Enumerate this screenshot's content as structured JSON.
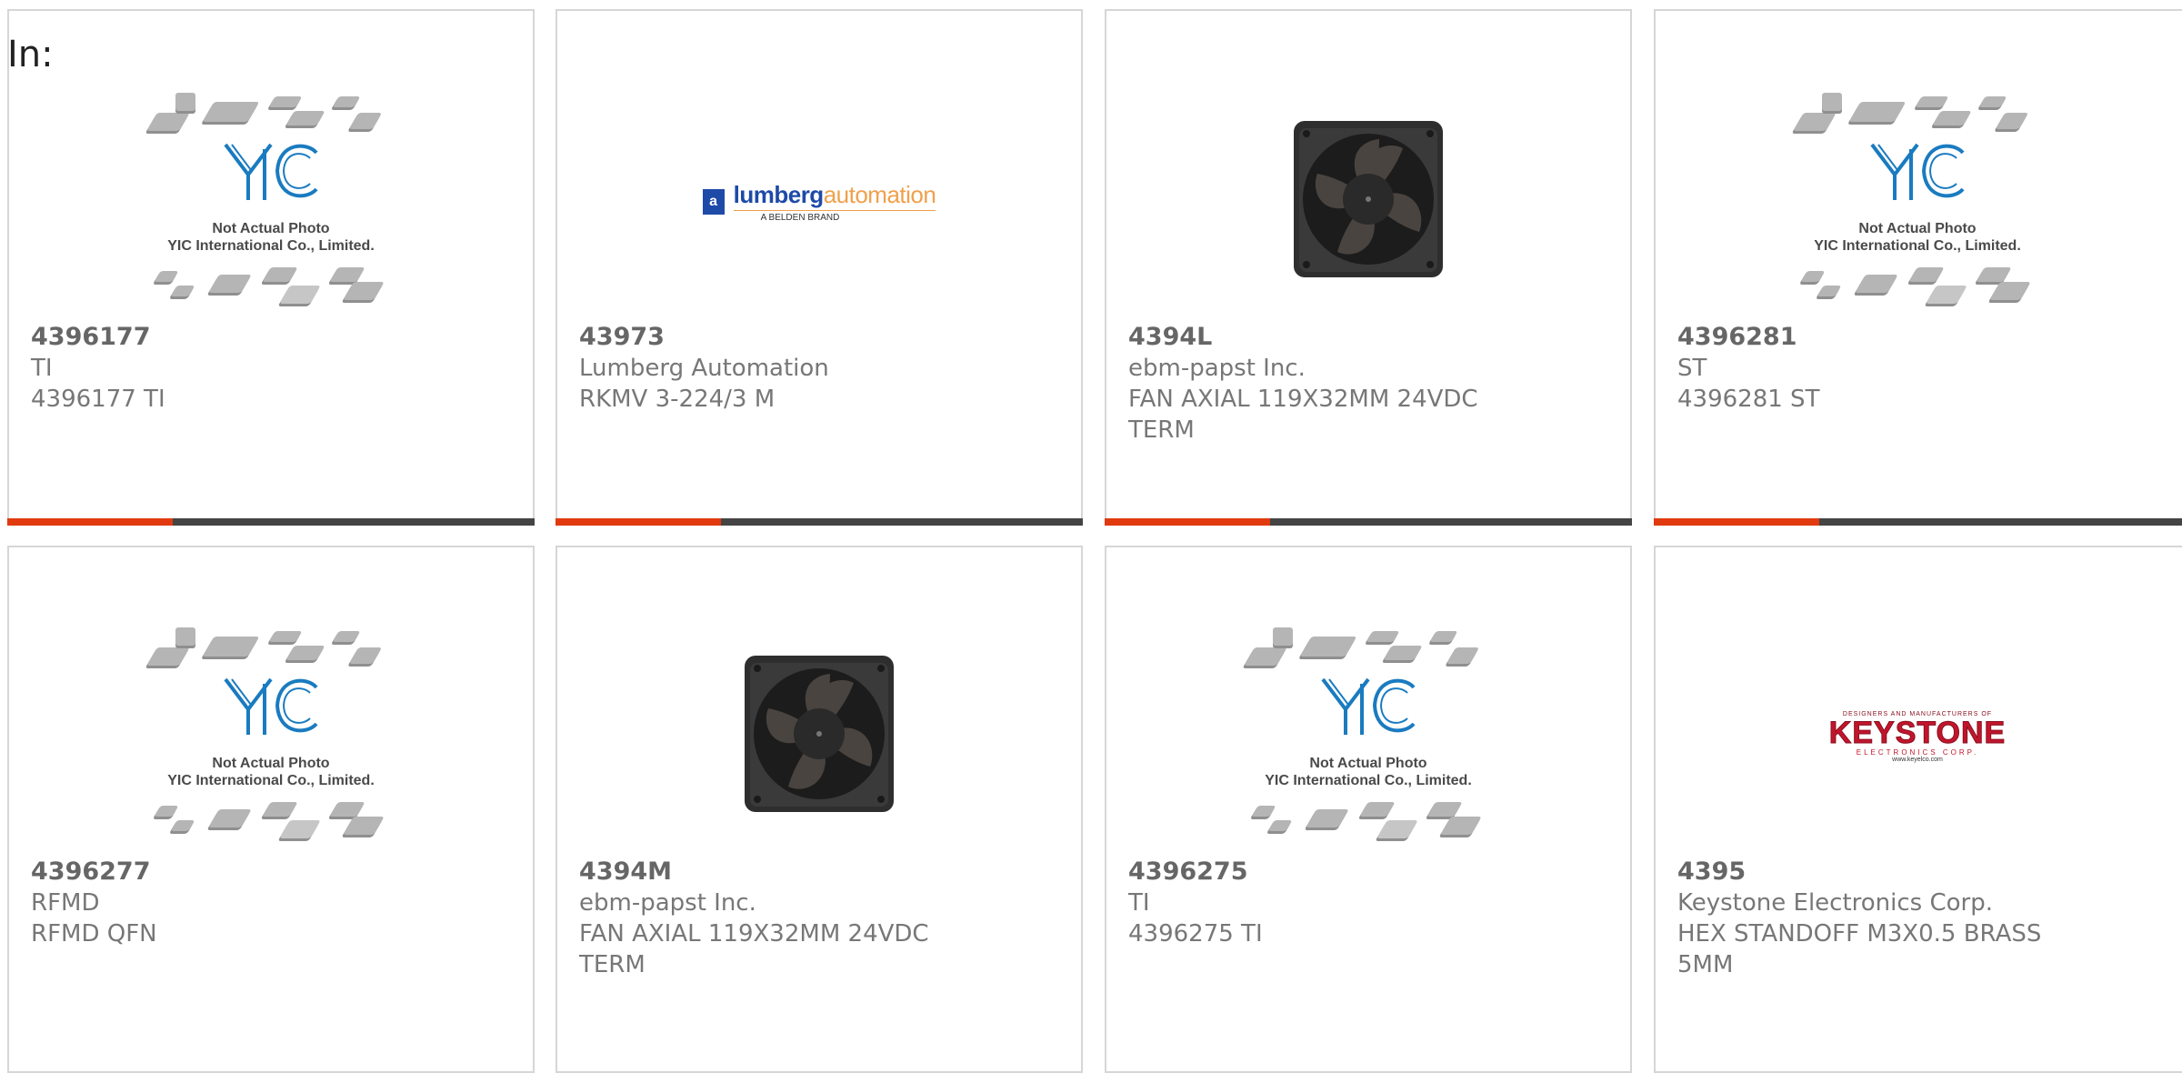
{
  "page": {
    "in_label": "In:"
  },
  "colors": {
    "accent": "#e03a0e",
    "bar": "#444444",
    "border": "#d6d6d6",
    "yic_blue": "#1a7bc0"
  },
  "placeholder": {
    "line1": "Not Actual Photo",
    "line2": "YIC International Co., Limited.",
    "logo_text": "YIC"
  },
  "logos": {
    "lumberg": {
      "mark": "a",
      "word1": "lumberg",
      "word2": "automation",
      "tagline": "A BELDEN BRAND"
    },
    "keystone": {
      "top": "DESIGNERS AND MANUFACTURERS OF",
      "main": "KEYSTONE",
      "mid": "ELECTRONICS CORP.",
      "url": "www.keyelco.com"
    }
  },
  "products": [
    {
      "part_number": "4396177",
      "manufacturer": "TI",
      "description": "4396177 TI",
      "image": "yic-placeholder"
    },
    {
      "part_number": "43973",
      "manufacturer": "Lumberg Automation",
      "description": "RKMV 3-224/3 M",
      "image": "lumberg-logo"
    },
    {
      "part_number": "4394L",
      "manufacturer": "ebm-papst Inc.",
      "description": "FAN AXIAL 119X32MM 24VDC TERM",
      "image": "fan-photo"
    },
    {
      "part_number": "4396281",
      "manufacturer": "ST",
      "description": "4396281 ST",
      "image": "yic-placeholder"
    },
    {
      "part_number": "4396277",
      "manufacturer": "RFMD",
      "description": "RFMD QFN",
      "image": "yic-placeholder"
    },
    {
      "part_number": "4394M",
      "manufacturer": "ebm-papst Inc.",
      "description": "FAN AXIAL 119X32MM 24VDC TERM",
      "image": "fan-photo"
    },
    {
      "part_number": "4396275",
      "manufacturer": "TI",
      "description": "4396275 TI",
      "image": "yic-placeholder"
    },
    {
      "part_number": "4395",
      "manufacturer": "Keystone Electronics Corp.",
      "description": "HEX STANDOFF M3X0.5 BRASS 5MM",
      "image": "keystone-logo"
    }
  ]
}
